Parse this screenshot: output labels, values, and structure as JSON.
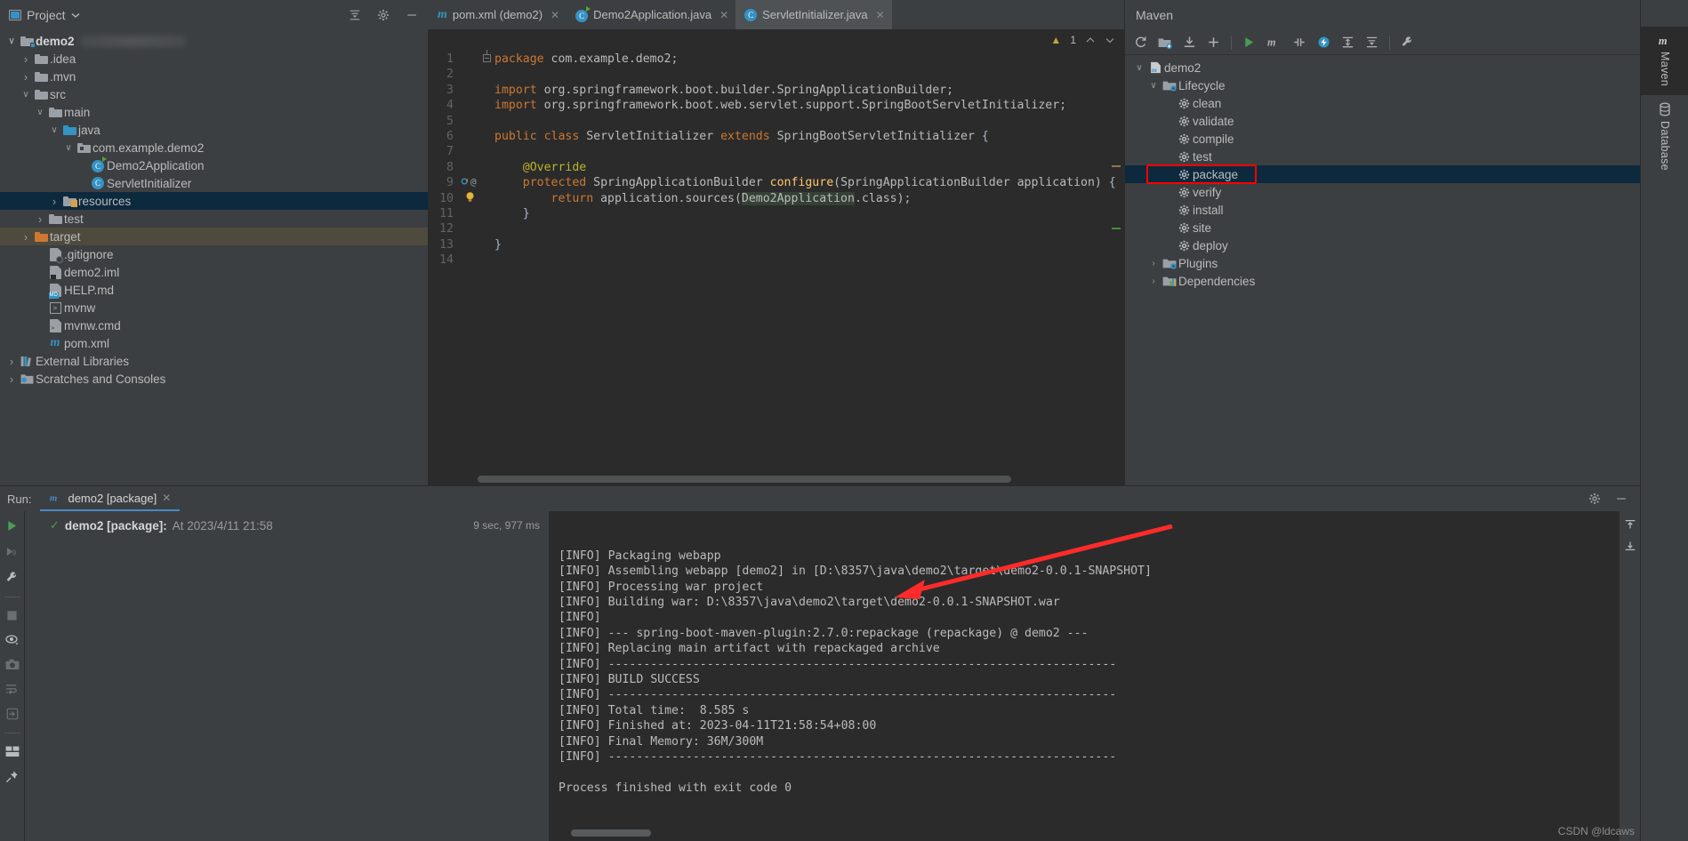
{
  "project": {
    "header_title": "Project",
    "icons": [
      "project-view-icon",
      "locate-icon",
      "collapse-all-icon",
      "settings-icon",
      "hide-icon"
    ],
    "tree": [
      {
        "label": "demo2",
        "depth": 0,
        "arrow": "v",
        "icon": "folder-module-icon",
        "bold": true,
        "blurred_suffix": true
      },
      {
        "label": ".idea",
        "depth": 1,
        "arrow": ">",
        "icon": "folder-icon"
      },
      {
        "label": ".mvn",
        "depth": 1,
        "arrow": ">",
        "icon": "folder-icon"
      },
      {
        "label": "src",
        "depth": 1,
        "arrow": "v",
        "icon": "folder-icon"
      },
      {
        "label": "main",
        "depth": 2,
        "arrow": "v",
        "icon": "folder-icon"
      },
      {
        "label": "java",
        "depth": 3,
        "arrow": "v",
        "icon": "folder-source-icon"
      },
      {
        "label": "com.example.demo2",
        "depth": 4,
        "arrow": "v",
        "icon": "package-icon"
      },
      {
        "label": "Demo2Application",
        "depth": 5,
        "arrow": "",
        "icon": "java-class-runnable-icon"
      },
      {
        "label": "ServletInitializer",
        "depth": 5,
        "arrow": "",
        "icon": "java-class-icon"
      },
      {
        "label": "resources",
        "depth": 3,
        "arrow": ">",
        "icon": "folder-resources-icon",
        "selected": "blue"
      },
      {
        "label": "test",
        "depth": 2,
        "arrow": ">",
        "icon": "folder-icon"
      },
      {
        "label": "target",
        "depth": 1,
        "arrow": ">",
        "icon": "folder-excluded-icon",
        "selected": "olive"
      },
      {
        "label": ".gitignore",
        "depth": 2,
        "arrow": "",
        "icon": "gitignore-file-icon"
      },
      {
        "label": "demo2.iml",
        "depth": 2,
        "arrow": "",
        "icon": "iml-file-icon"
      },
      {
        "label": "HELP.md",
        "depth": 2,
        "arrow": "",
        "icon": "markdown-file-icon"
      },
      {
        "label": "mvnw",
        "depth": 2,
        "arrow": "",
        "icon": "shell-file-icon"
      },
      {
        "label": "mvnw.cmd",
        "depth": 2,
        "arrow": "",
        "icon": "cmd-file-icon"
      },
      {
        "label": "pom.xml",
        "depth": 2,
        "arrow": "",
        "icon": "maven-pom-icon"
      },
      {
        "label": "External Libraries",
        "depth": 0,
        "arrow": ">",
        "icon": "libraries-icon"
      },
      {
        "label": "Scratches and Consoles",
        "depth": 0,
        "arrow": ">",
        "icon": "scratches-icon"
      }
    ]
  },
  "editor": {
    "tabs": [
      {
        "label": "pom.xml (demo2)",
        "icon": "maven-pom-icon",
        "active": false,
        "closable": true
      },
      {
        "label": "Demo2Application.java",
        "icon": "java-class-runnable-icon",
        "active": false,
        "closable": true
      },
      {
        "label": "ServletInitializer.java",
        "icon": "java-class-icon",
        "active": true,
        "closable": true
      }
    ],
    "inspection": {
      "warning_count": "1",
      "warning_icon": "warning-triangle-icon",
      "up_icon": "chevron-up-icon",
      "down_icon": "chevron-down-icon"
    },
    "lines": [
      {
        "n": "1",
        "text": "package com.example.demo2;"
      },
      {
        "n": "2",
        "text": ""
      },
      {
        "n": "3",
        "text": "import org.springframework.boot.builder.SpringApplicationBuilder;"
      },
      {
        "n": "4",
        "text": "import org.springframework.boot.web.servlet.support.SpringBootServletInitializer;"
      },
      {
        "n": "5",
        "text": ""
      },
      {
        "n": "6",
        "text": "public class ServletInitializer extends SpringBootServletInitializer {"
      },
      {
        "n": "7",
        "text": ""
      },
      {
        "n": "8",
        "text": "    @Override"
      },
      {
        "n": "9",
        "text": "    protected SpringApplicationBuilder configure(SpringApplicationBuilder application) {"
      },
      {
        "n": "10",
        "text": "        return application.sources(Demo2Application.class);"
      },
      {
        "n": "11",
        "text": "    }"
      },
      {
        "n": "12",
        "text": ""
      },
      {
        "n": "13",
        "text": "}"
      },
      {
        "n": "14",
        "text": ""
      }
    ]
  },
  "maven": {
    "title": "Maven",
    "toolbar_icons": [
      "reload-icon",
      "add-module-icon",
      "download-sources-icon",
      "plus-icon",
      "run-icon",
      "execute-goal-icon",
      "toggle-skip-tests-icon",
      "toggle-offline-icon",
      "expand-icon",
      "collapse-all-icon",
      "settings-wrench-icon"
    ],
    "tree": [
      {
        "label": "demo2",
        "depth": 0,
        "arrow": "v",
        "icon": "maven-project-icon"
      },
      {
        "label": "Lifecycle",
        "depth": 1,
        "arrow": "v",
        "icon": "lifecycle-folder-icon"
      },
      {
        "label": "clean",
        "depth": 2,
        "arrow": "",
        "icon": "goal-gear-icon"
      },
      {
        "label": "validate",
        "depth": 2,
        "arrow": "",
        "icon": "goal-gear-icon"
      },
      {
        "label": "compile",
        "depth": 2,
        "arrow": "",
        "icon": "goal-gear-icon"
      },
      {
        "label": "test",
        "depth": 2,
        "arrow": "",
        "icon": "goal-gear-icon"
      },
      {
        "label": "package",
        "depth": 2,
        "arrow": "",
        "icon": "goal-gear-icon",
        "selected": true,
        "highlighted": true
      },
      {
        "label": "verify",
        "depth": 2,
        "arrow": "",
        "icon": "goal-gear-icon"
      },
      {
        "label": "install",
        "depth": 2,
        "arrow": "",
        "icon": "goal-gear-icon"
      },
      {
        "label": "site",
        "depth": 2,
        "arrow": "",
        "icon": "goal-gear-icon"
      },
      {
        "label": "deploy",
        "depth": 2,
        "arrow": "",
        "icon": "goal-gear-icon"
      },
      {
        "label": "Plugins",
        "depth": 1,
        "arrow": ">",
        "icon": "plugins-folder-icon"
      },
      {
        "label": "Dependencies",
        "depth": 1,
        "arrow": ">",
        "icon": "dependencies-folder-icon"
      }
    ],
    "highlight_color": "#ff0000"
  },
  "right_rail": {
    "tabs": [
      {
        "label": "Maven",
        "icon": "maven-m-icon",
        "active": true
      },
      {
        "label": "Database",
        "icon": "database-icon",
        "active": false
      }
    ]
  },
  "run_panel": {
    "run_label": "Run:",
    "tab": {
      "label": "demo2 [package]",
      "icon": "maven-m-icon",
      "close_icon": "close-icon"
    },
    "toolbar_icons": [
      "settings-icon",
      "hide-icon"
    ],
    "side_icons": [
      "rerun-icon",
      "rerun-failed-icon",
      "wrench-icon",
      "stop-icon",
      "eye-filter-icon",
      "camera-icon",
      "soft-wrap-icon",
      "scroll-to-end-icon",
      "layout-icon",
      "pin-icon"
    ],
    "right_icons": [
      "up-icon",
      "down-icon"
    ],
    "tree_row": {
      "status_icon": "check-icon",
      "title": "demo2 [package]:",
      "subtitle": "At 2023/4/11 21:58",
      "duration": "9 sec, 977 ms"
    },
    "console_lines": [
      "[INFO] Packaging webapp",
      "[INFO] Assembling webapp [demo2] in [D:\\8357\\java\\demo2\\target\\demo2-0.0.1-SNAPSHOT]",
      "[INFO] Processing war project",
      "[INFO] Building war: D:\\8357\\java\\demo2\\target\\demo2-0.0.1-SNAPSHOT.war",
      "[INFO] ",
      "[INFO] --- spring-boot-maven-plugin:2.7.0:repackage (repackage) @ demo2 ---",
      "[INFO] Replacing main artifact with repackaged archive",
      "[INFO] ------------------------------------------------------------------------",
      "[INFO] BUILD SUCCESS",
      "[INFO] ------------------------------------------------------------------------",
      "[INFO] Total time:  8.585 s",
      "[INFO] Finished at: 2023-04-11T21:58:54+08:00",
      "[INFO] Final Memory: 36M/300M",
      "[INFO] ------------------------------------------------------------------------",
      "",
      "Process finished with exit code 0"
    ]
  },
  "annotation": {
    "arrow_color": "#ff2b2b",
    "name": "red-pointer-arrow"
  },
  "watermark": "CSDN @ldcaws"
}
